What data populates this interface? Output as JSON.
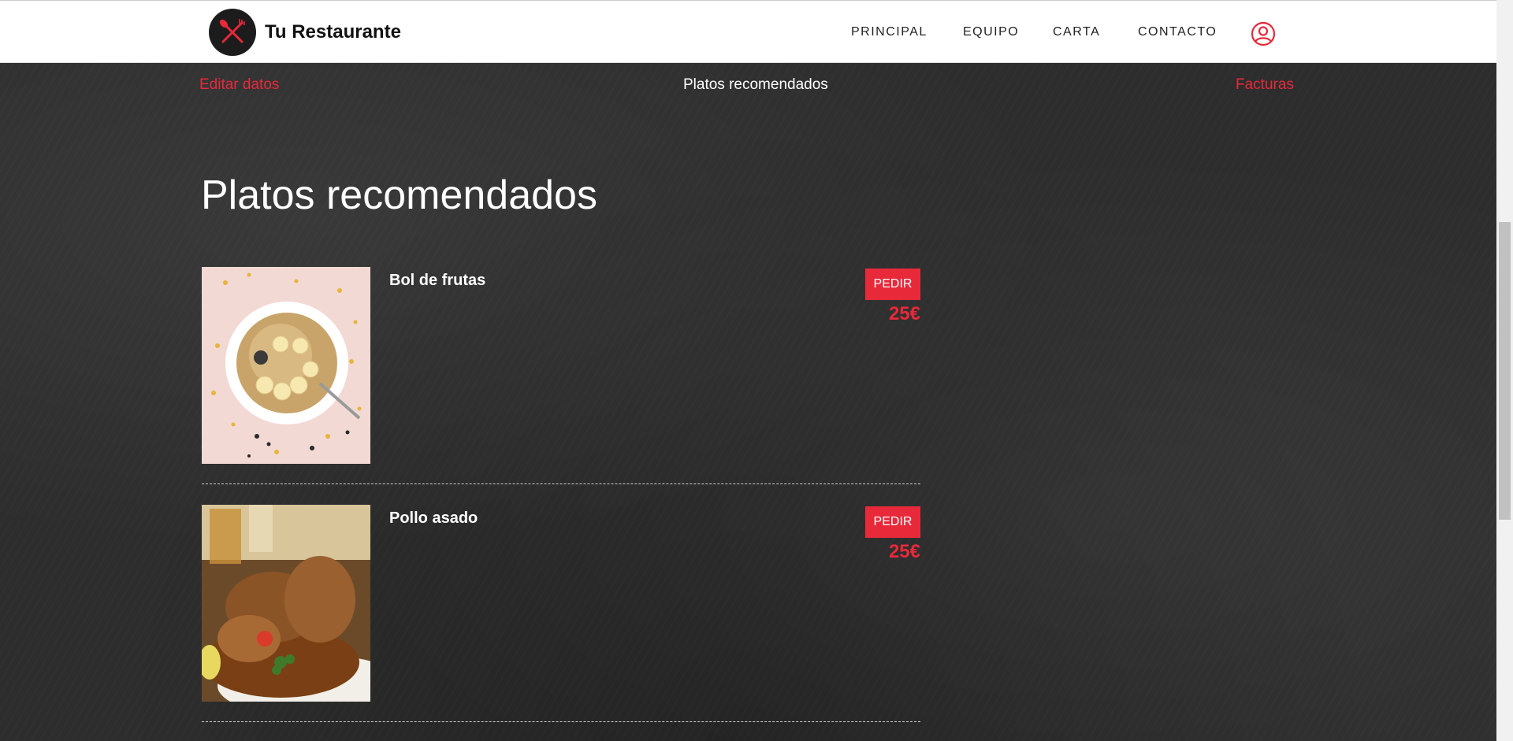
{
  "header": {
    "brand": "Tu Restaurante",
    "nav": [
      "PRINCIPAL",
      "EQUIPO",
      "CARTA",
      "CONTACTO"
    ]
  },
  "subnav": {
    "edit": "Editar datos",
    "recommended": "Platos recomendados",
    "invoices": "Facturas"
  },
  "main": {
    "title": "Platos recomendados",
    "dishes": [
      {
        "name": "Bol de frutas",
        "button": "PEDIR",
        "price": "25€"
      },
      {
        "name": "Pollo asado",
        "button": "PEDIR",
        "price": "25€"
      }
    ]
  },
  "colors": {
    "accent": "#e8293a",
    "header_bg": "#ffffff",
    "page_bg": "#2d2d2d"
  }
}
